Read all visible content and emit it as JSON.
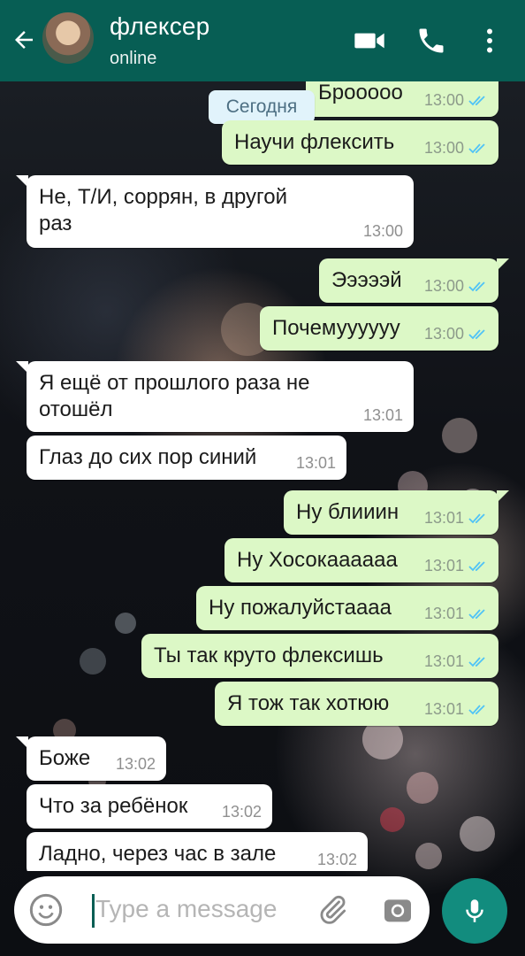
{
  "header": {
    "contact_name": "флексер",
    "status": "online"
  },
  "chat": {
    "date_label": "Сегодня",
    "messages": [
      {
        "dir": "out",
        "text": "Брооооо",
        "time": "13:00",
        "ticks": "read"
      },
      {
        "dir": "out",
        "text": "Научи флексить",
        "time": "13:00",
        "ticks": "read"
      },
      {
        "dir": "in",
        "text": "Не, Т/И, соррян, в другой раз",
        "line1": "Не, Т/И, соррян, в другой",
        "line2": "раз",
        "time": "13:00"
      },
      {
        "dir": "out",
        "text": "Эээээй",
        "time": "13:00",
        "ticks": "read"
      },
      {
        "dir": "out",
        "text": "Почемуууууу",
        "time": "13:00",
        "ticks": "read"
      },
      {
        "dir": "in",
        "text": "Я ещё от прошлого раза не отошёл",
        "line1": "Я ещё от прошлого раза не",
        "line2": "отошёл",
        "time": "13:01"
      },
      {
        "dir": "in",
        "text": "Глаз до сих пор синий",
        "time": "13:01"
      },
      {
        "dir": "out",
        "text": "Ну блииин",
        "time": "13:01",
        "ticks": "read"
      },
      {
        "dir": "out",
        "text": "Ну Хосокаааааа",
        "time": "13:01",
        "ticks": "read"
      },
      {
        "dir": "out",
        "text": "Ну пожалуйстаааа",
        "time": "13:01",
        "ticks": "read"
      },
      {
        "dir": "out",
        "text": "Ты так круто флексишь",
        "time": "13:01",
        "ticks": "read"
      },
      {
        "dir": "out",
        "text": "Я тож так хотюю",
        "time": "13:01",
        "ticks": "read"
      },
      {
        "dir": "in",
        "text": "Боже",
        "time": "13:02"
      },
      {
        "dir": "in",
        "text": "Что за ребёнок",
        "time": "13:02"
      },
      {
        "dir": "in",
        "text": "Ладно, через час в зале",
        "time": "13:02"
      }
    ]
  },
  "input": {
    "placeholder": "Type a message"
  },
  "icons": {
    "back": "arrow-left-icon",
    "video": "video-camera-icon",
    "call": "phone-icon",
    "menu": "more-vertical-icon",
    "emoji": "emoji-icon",
    "attach": "paperclip-icon",
    "camera": "camera-icon",
    "mic": "microphone-icon",
    "read": "double-check-icon"
  },
  "colors": {
    "header": "#075e54",
    "outgoing_bubble": "#dcf8c6",
    "incoming_bubble": "#ffffff",
    "read_ticks": "#4fc3f7",
    "mic_button": "#128c7e"
  }
}
